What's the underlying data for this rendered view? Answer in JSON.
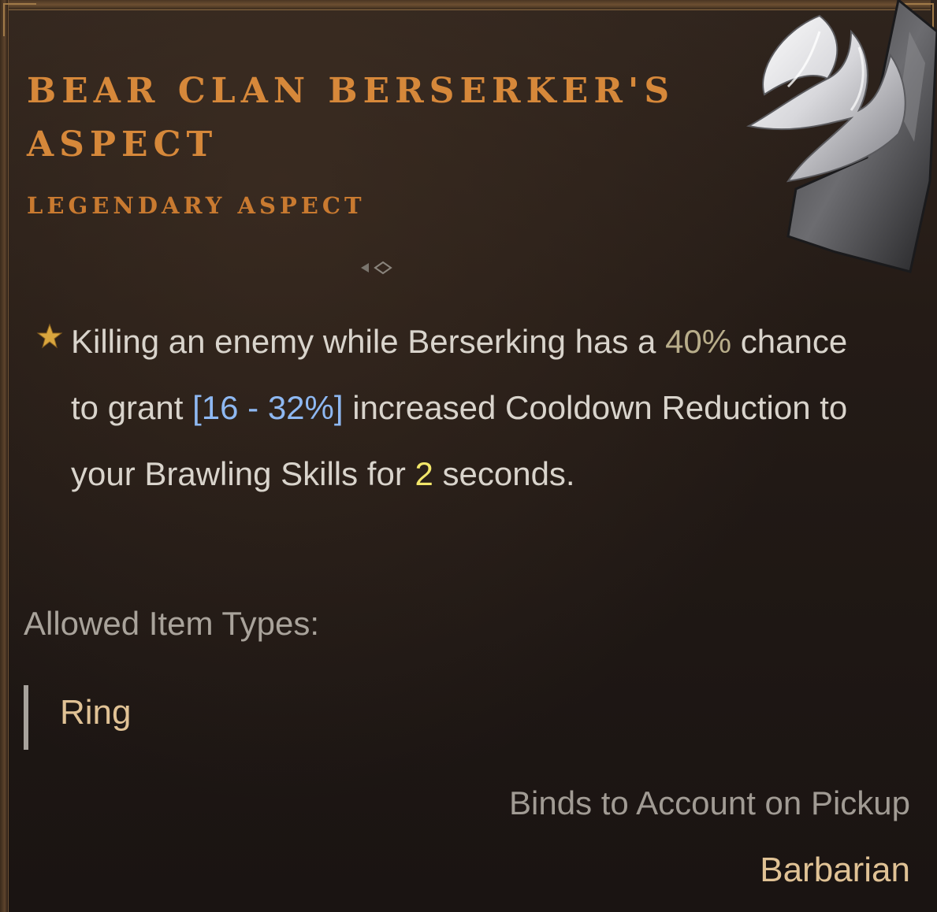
{
  "aspect": {
    "title": "Bear Clan Berserker's Aspect",
    "rarity": "Legendary Aspect",
    "icon": "feather-wing-emblem-icon",
    "bullet_icon": "star-icon"
  },
  "description": {
    "p1": "Killing an enemy while Berserking has a ",
    "chance": "40%",
    "p2": " chance to grant ",
    "range": "[16 - 32%]",
    "p3": " increased Cooldown Reduction to your Brawling Skills for ",
    "duration": "2",
    "p4": " seconds."
  },
  "allowed": {
    "label": "Allowed Item Types:",
    "items": [
      "Ring"
    ]
  },
  "footer": {
    "binding": "Binds to Account on Pickup",
    "class_requirement": "Barbarian"
  },
  "colors": {
    "title": "#d6883a",
    "range_value": "#8eb8f2",
    "duration_value": "#f2e66a",
    "fixed_value": "#b8ad8a"
  }
}
